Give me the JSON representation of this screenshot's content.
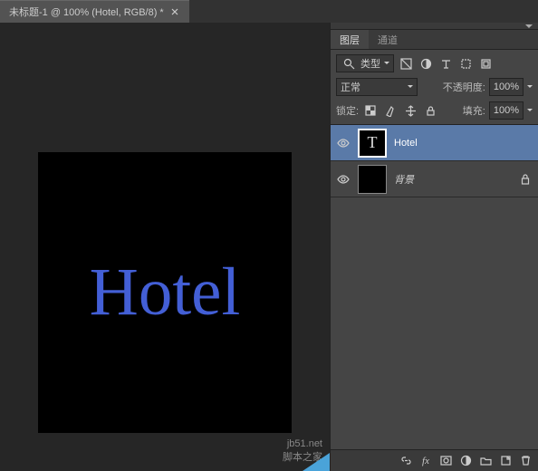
{
  "tab": {
    "title": "未标题-1 @ 100% (Hotel, RGB/8) *"
  },
  "canvas": {
    "text": "Hotel"
  },
  "panel": {
    "tabs": {
      "layers": "图层",
      "channels": "通道"
    },
    "filter_label": "类型",
    "blend_mode": "正常",
    "opacity_label": "不透明度:",
    "opacity_value": "100%",
    "lock_label": "锁定:",
    "fill_label": "填充:",
    "fill_value": "100%"
  },
  "layers": [
    {
      "name": "Hotel",
      "type": "text",
      "selected": true,
      "locked": false
    },
    {
      "name": "背景",
      "type": "raster",
      "selected": false,
      "locked": true
    }
  ],
  "bottom": {
    "fx": "fx"
  },
  "watermark": {
    "line1": "jb51.net",
    "line2": "脚本之家"
  }
}
